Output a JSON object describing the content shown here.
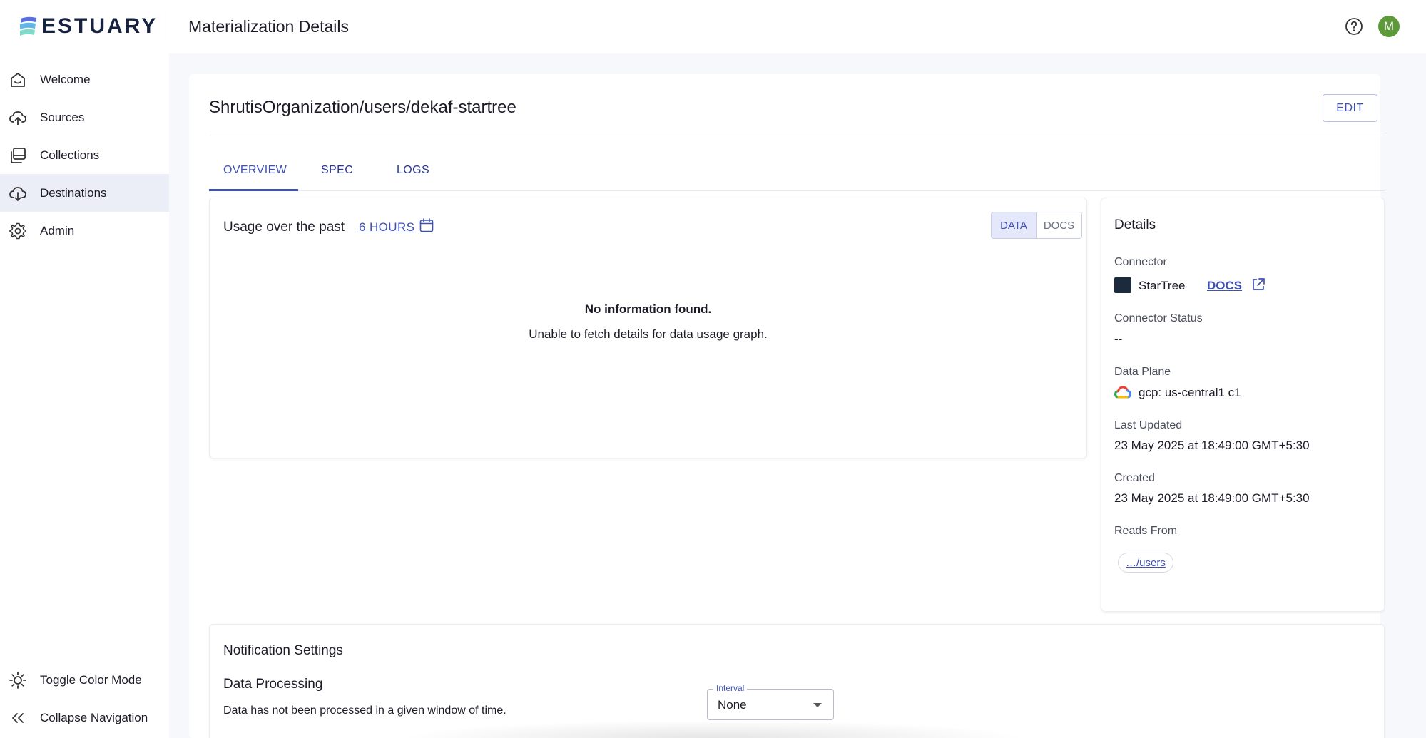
{
  "brand": {
    "name": "ESTUARY"
  },
  "header": {
    "title": "Materialization Details",
    "avatar_initial": "M"
  },
  "sidebar": {
    "items": [
      {
        "label": "Welcome",
        "icon": "home-icon"
      },
      {
        "label": "Sources",
        "icon": "cloud-upload-icon"
      },
      {
        "label": "Collections",
        "icon": "collections-icon"
      },
      {
        "label": "Destinations",
        "icon": "cloud-download-icon",
        "active": true
      },
      {
        "label": "Admin",
        "icon": "gear-icon"
      }
    ],
    "footer": [
      {
        "label": "Toggle Color Mode",
        "icon": "sun-icon"
      },
      {
        "label": "Collapse Navigation",
        "icon": "double-chevron-left-icon"
      }
    ]
  },
  "main": {
    "entity_name": "ShrutisOrganization/users/dekaf-startree",
    "edit_label": "EDIT",
    "tabs": [
      {
        "label": "OVERVIEW",
        "active": true
      },
      {
        "label": "SPEC"
      },
      {
        "label": "LOGS"
      }
    ],
    "usage": {
      "label": "Usage over the past",
      "range": "6 HOURS",
      "toggle": [
        "DATA",
        "DOCS"
      ],
      "toggle_active": "DATA",
      "empty_title": "No information found.",
      "empty_message": "Unable to fetch details for data usage graph."
    },
    "details": {
      "title": "Details",
      "connector_label": "Connector",
      "connector_name": "StarTree",
      "docs_label": "DOCS",
      "status_label": "Connector Status",
      "status_value": "--",
      "data_plane_label": "Data Plane",
      "data_plane_value": "gcp: us-central1 c1",
      "updated_label": "Last Updated",
      "updated_value": "23 May 2025 at 18:49:00 GMT+5:30",
      "created_label": "Created",
      "created_value": "23 May 2025 at 18:49:00 GMT+5:30",
      "reads_from_label": "Reads From",
      "reads_from_value": "…/users"
    },
    "notifications": {
      "title": "Notification Settings",
      "section_title": "Data Processing",
      "section_desc": "Data has not been processed in a given window of time.",
      "interval_label": "Interval",
      "interval_value": "None"
    }
  },
  "colors": {
    "accent": "#3f51b5",
    "nav_active_bg": "#eceef7",
    "avatar": "#5c9a3a",
    "background": "#f7f8fc"
  }
}
